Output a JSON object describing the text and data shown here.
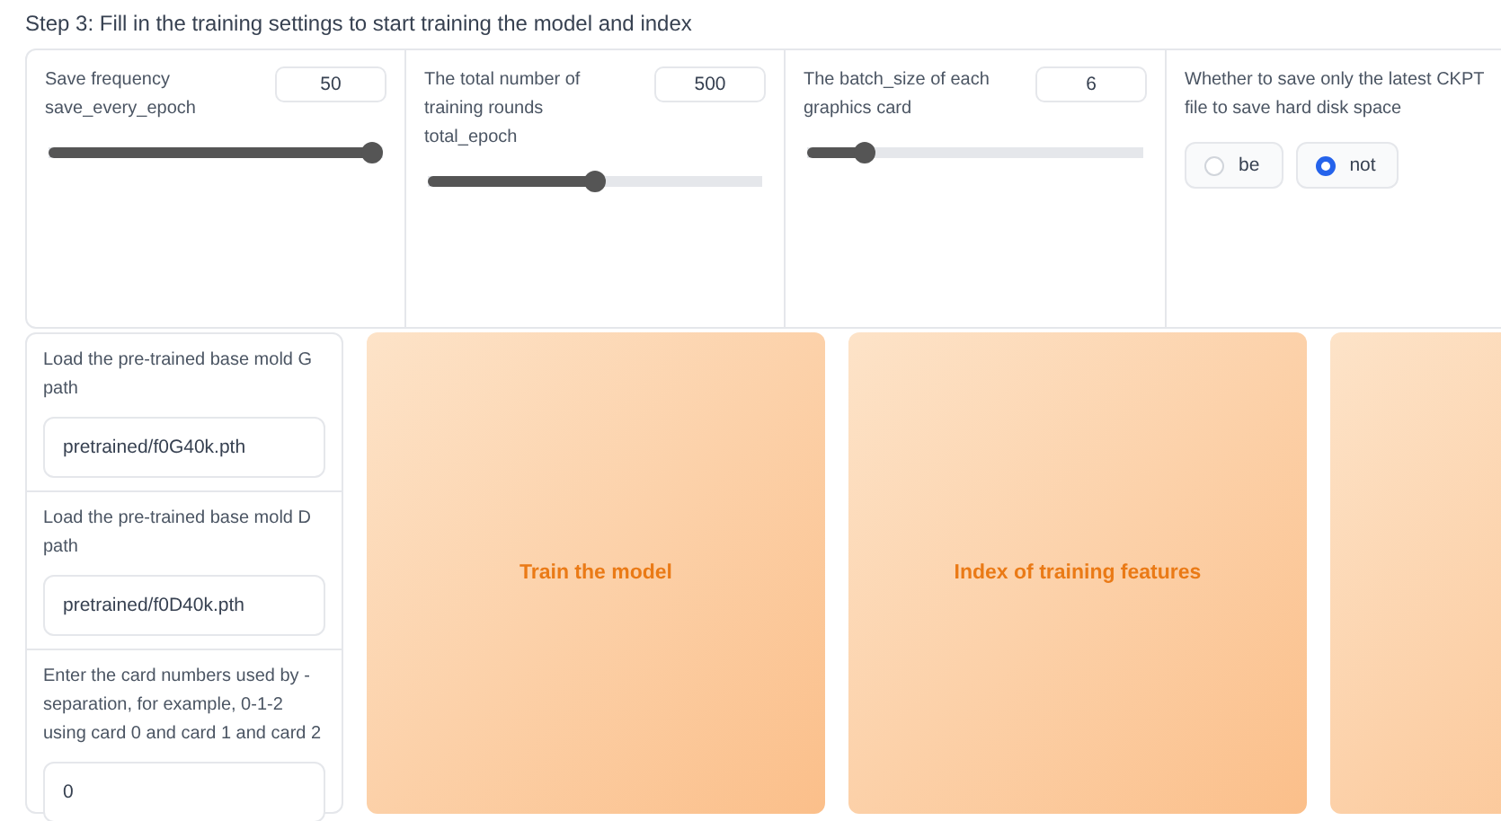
{
  "heading": "Step 3: Fill in the training settings to start training the model and index",
  "sliders": [
    {
      "label": "Save frequency save_every_epoch",
      "value": "50",
      "level": 1.0
    },
    {
      "label": "The total number of training rounds total_epoch",
      "value": "500",
      "level": 0.5
    },
    {
      "label": "The batch_size of each graphics card",
      "value": "6",
      "level": 0.15
    }
  ],
  "save_latest": {
    "label": "Whether to save only the latest CKPT file to save hard disk space",
    "options": [
      {
        "label": "be",
        "selected": false
      },
      {
        "label": "not",
        "selected": true
      }
    ]
  },
  "paths": [
    {
      "label": "Load the pre-trained base mold G path",
      "value": "pretrained/f0G40k.pth"
    },
    {
      "label": "Load the pre-trained base mold D path",
      "value": "pretrained/f0D40k.pth"
    },
    {
      "label": "Enter the card numbers used by - separation, for example, 0-1-2 using card 0 and card 1 and card 2",
      "value": "0"
    }
  ],
  "actions": [
    {
      "kind": "labeled",
      "label": "Train the model"
    },
    {
      "kind": "labeled",
      "label": "Index of training features"
    },
    {
      "kind": "blank"
    }
  ]
}
